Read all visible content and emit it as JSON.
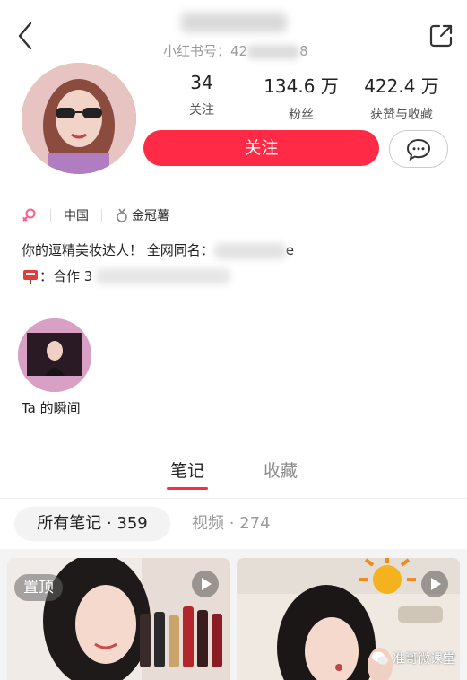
{
  "header": {
    "rednote_label": "小红书号：42",
    "rednote_suffix": "8"
  },
  "stats": [
    {
      "value": "34",
      "label": "关注"
    },
    {
      "value": "134.6 万",
      "label": "粉丝"
    },
    {
      "value": "422.4 万",
      "label": "获赞与收藏"
    }
  ],
  "actions": {
    "follow_label": "关注"
  },
  "tags": {
    "location": "中国",
    "badge": "金冠薯"
  },
  "bio": {
    "line1_prefix": "你的逗精美妆达人！   全网同名：",
    "line1_suffix": "e",
    "collab_prefix": "：合作 3"
  },
  "moments": {
    "label": "Ta 的瞬间"
  },
  "tabs": {
    "notes": "笔记",
    "favorites": "收藏"
  },
  "filters": {
    "all": "所有笔记 · 359",
    "video": "视频 · 274"
  },
  "grid": {
    "pin_label": "置顶"
  },
  "watermark": {
    "text": "准哥微课堂"
  },
  "colors": {
    "accent": "#ff2b46"
  }
}
